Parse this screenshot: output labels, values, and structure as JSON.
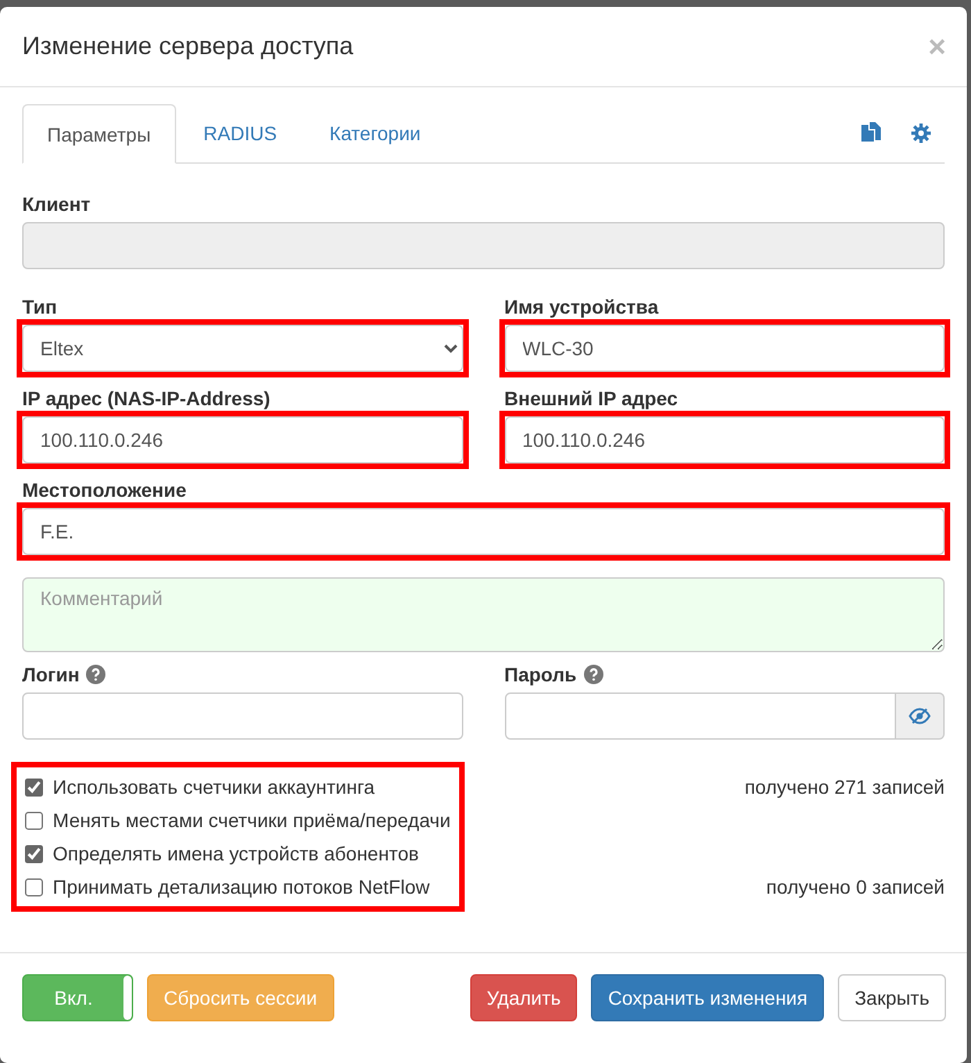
{
  "modal": {
    "title": "Изменение сервера доступа",
    "close": "×"
  },
  "tabs": [
    {
      "label": "Параметры",
      "selected": true
    },
    {
      "label": "RADIUS",
      "selected": false
    },
    {
      "label": "Категории",
      "selected": false
    }
  ],
  "client": {
    "label": "Клиент",
    "disabled": true,
    "highlighted": false
  },
  "rows": [
    [
      {
        "kind": "select",
        "label": "Тип",
        "value": "Eltex",
        "highlighted": true
      },
      {
        "kind": "text",
        "label": "Имя устройства",
        "value": "WLC-30",
        "highlighted": true
      }
    ],
    [
      {
        "kind": "text",
        "label": "IP адрес (NAS-IP-Address)",
        "value": "100.110.0.246",
        "highlighted": true
      },
      {
        "kind": "text",
        "label": "Внешний IP адрес",
        "value": "100.110.0.246",
        "highlighted": true
      }
    ]
  ],
  "location": {
    "label": "Местоположение",
    "value": "F.E.",
    "highlighted": true
  },
  "comment": {
    "placeholder": "Комментарий"
  },
  "login": {
    "label": "Логин"
  },
  "password": {
    "label": "Пароль"
  },
  "options": {
    "highlighted": true,
    "items": [
      {
        "label": "Использовать счетчики аккаунтинга",
        "checked": true,
        "note": "получено 271 записей"
      },
      {
        "label": "Менять местами счетчики приёма/передачи",
        "checked": false
      },
      {
        "label": "Определять имена устройств абонентов",
        "checked": true
      },
      {
        "label": "Принимать детализацию потоков NetFlow",
        "checked": false,
        "note": "получено 0 записей"
      }
    ]
  },
  "toggle": {
    "label": "Вкл.",
    "on": true
  },
  "buttons": [
    {
      "kind": "warning",
      "label": "Сбросить сессии"
    },
    {
      "kind": "danger",
      "label": "Удалить"
    },
    {
      "kind": "primary",
      "label": "Сохранить изменения"
    },
    {
      "kind": "default",
      "label": "Закрыть"
    }
  ]
}
